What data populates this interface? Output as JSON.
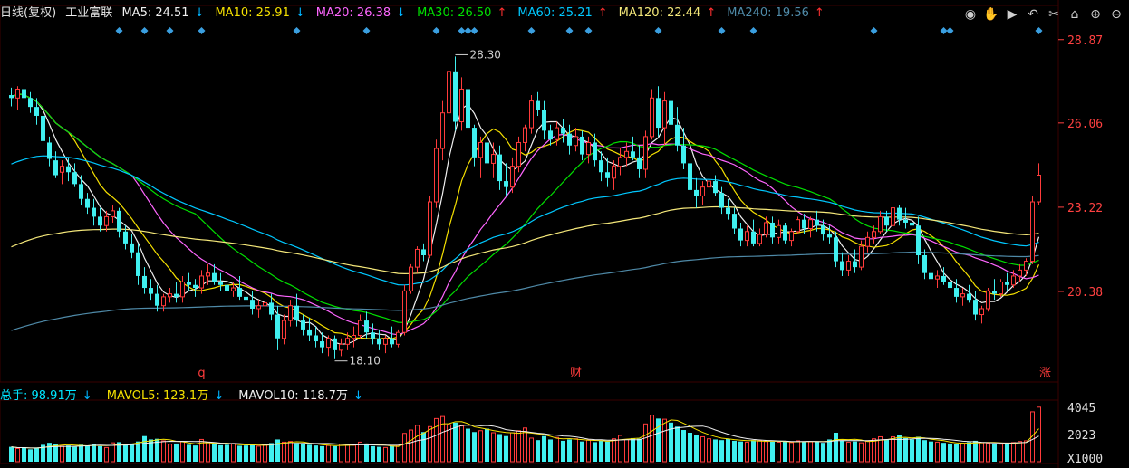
{
  "header": {
    "title": "日线(复权)",
    "stock_name": "工业富联",
    "indicators": [
      {
        "label": "MA5: 24.51",
        "arrow": "↓",
        "arrow_color": "#00b4ff",
        "color": "#f0f0f0"
      },
      {
        "label": "MA10: 25.91",
        "arrow": "↓",
        "arrow_color": "#00b4ff",
        "color": "#f5e000"
      },
      {
        "label": "MA20: 26.38",
        "arrow": "↓",
        "arrow_color": "#00b4ff",
        "color": "#ff66ff"
      },
      {
        "label": "MA30: 26.50",
        "arrow": "↑",
        "arrow_color": "#ff3030",
        "color": "#00e000"
      },
      {
        "label": "MA60: 25.21",
        "arrow": "↑",
        "arrow_color": "#ff3030",
        "color": "#00c8ff"
      },
      {
        "label": "MA120: 22.44",
        "arrow": "↑",
        "arrow_color": "#ff3030",
        "color": "#f5e87a"
      },
      {
        "label": "MA240: 19.56",
        "arrow": "↑",
        "arrow_color": "#ff3030",
        "color": "#4f8aa8"
      }
    ]
  },
  "toolbar": [
    "eye-icon",
    "hand-icon",
    "play-icon",
    "undo-icon",
    "scissors-icon",
    "lock-icon",
    "zoom-in-icon",
    "zoom-out-icon"
  ],
  "volume_header": {
    "total": {
      "label": "总手: 98.91万",
      "arrow": "↓",
      "color": "#00e5ff",
      "arrow_color": "#00b4ff"
    },
    "mavol5": {
      "label": "MAVOL5: 123.1万",
      "arrow": "↓",
      "color": "#f5e000",
      "arrow_color": "#00b4ff"
    },
    "mavol10": {
      "label": "MAVOL10: 118.7万",
      "arrow": "↓",
      "color": "#f0f0f0",
      "arrow_color": "#00b4ff"
    }
  },
  "colors": {
    "up": "#ff3b3b",
    "down": "#40f0f0",
    "grid": "#3a0000",
    "price_axis": "#ff4040",
    "vol_axis": "#e0e0e0",
    "diamond": "#3a9fe0"
  },
  "chart_data": {
    "type": "candlestick",
    "price_axis": {
      "ticks": [
        28.87,
        26.06,
        23.22,
        20.38
      ],
      "labels": [
        "28.87",
        "26.06",
        "23.22",
        "20.38"
      ],
      "ylim": [
        17.45,
        29.9
      ]
    },
    "volume_axis": {
      "ticks": [
        4045,
        2023
      ],
      "labels": [
        "4045",
        "2023"
      ],
      "unit_label": "X1000",
      "ylim": [
        0,
        4300
      ]
    },
    "annotations": [
      {
        "text": "28.30",
        "index": 70
      },
      {
        "text": "18.10",
        "index": 51
      }
    ],
    "event_markers": [
      {
        "text": "q",
        "index": 30
      },
      {
        "text": "财",
        "index": 89
      },
      {
        "text": "涨",
        "index": 163
      }
    ],
    "diamond_markers": [
      17,
      21,
      25,
      30,
      45,
      56,
      67,
      71,
      72,
      73,
      82,
      88,
      91,
      102,
      112,
      117,
      136,
      147,
      148,
      162
    ],
    "candles": [
      [
        27.0,
        27.25,
        26.62,
        26.9
      ],
      [
        26.9,
        27.3,
        26.5,
        27.2
      ],
      [
        27.2,
        27.4,
        26.8,
        26.9
      ],
      [
        26.9,
        27.1,
        26.4,
        26.6
      ],
      [
        26.6,
        26.9,
        26.0,
        26.3
      ],
      [
        26.3,
        26.5,
        25.2,
        25.45
      ],
      [
        25.4,
        25.6,
        24.6,
        24.85
      ],
      [
        24.8,
        25.1,
        24.2,
        24.3
      ],
      [
        24.4,
        24.8,
        24.0,
        24.6
      ],
      [
        24.6,
        24.9,
        24.1,
        24.4
      ],
      [
        24.4,
        24.7,
        23.9,
        24.0
      ],
      [
        24.0,
        24.3,
        23.3,
        23.5
      ],
      [
        23.5,
        23.7,
        23.0,
        23.2
      ],
      [
        23.2,
        23.5,
        22.6,
        22.9
      ],
      [
        22.9,
        23.2,
        22.4,
        22.6
      ],
      [
        22.6,
        23.1,
        22.4,
        22.9
      ],
      [
        22.9,
        23.3,
        22.7,
        23.1
      ],
      [
        23.1,
        23.2,
        22.2,
        22.4
      ],
      [
        22.4,
        22.6,
        21.8,
        22.0
      ],
      [
        22.0,
        22.3,
        21.5,
        21.7
      ],
      [
        21.7,
        22.0,
        20.6,
        20.9
      ],
      [
        20.9,
        21.2,
        20.3,
        20.5
      ],
      [
        20.5,
        20.8,
        20.1,
        20.3
      ],
      [
        20.3,
        20.6,
        19.7,
        19.9
      ],
      [
        19.9,
        20.3,
        19.7,
        20.2
      ],
      [
        20.2,
        20.5,
        20.0,
        20.3
      ],
      [
        20.3,
        20.7,
        20.0,
        20.2
      ],
      [
        20.2,
        20.9,
        20.0,
        20.7
      ],
      [
        20.7,
        21.0,
        20.4,
        20.6
      ],
      [
        20.6,
        20.8,
        20.2,
        20.5
      ],
      [
        20.5,
        21.1,
        20.3,
        20.9
      ],
      [
        20.9,
        21.3,
        20.6,
        21.0
      ],
      [
        21.0,
        21.3,
        20.6,
        20.7
      ],
      [
        20.7,
        21.0,
        20.4,
        20.6
      ],
      [
        20.6,
        20.8,
        20.1,
        20.4
      ],
      [
        20.4,
        20.7,
        20.2,
        20.5
      ],
      [
        20.5,
        20.9,
        20.1,
        20.2
      ],
      [
        20.2,
        20.5,
        19.9,
        20.1
      ],
      [
        20.1,
        20.4,
        19.6,
        19.8
      ],
      [
        19.8,
        20.1,
        19.5,
        19.9
      ],
      [
        19.9,
        20.2,
        19.7,
        20.0
      ],
      [
        20.0,
        20.3,
        19.4,
        19.6
      ],
      [
        19.6,
        19.9,
        18.4,
        18.8
      ],
      [
        18.8,
        19.6,
        18.6,
        19.4
      ],
      [
        19.4,
        20.1,
        19.2,
        19.9
      ],
      [
        19.9,
        20.3,
        19.2,
        19.4
      ],
      [
        19.4,
        19.6,
        18.9,
        19.1
      ],
      [
        19.1,
        19.5,
        18.7,
        18.9
      ],
      [
        18.9,
        19.2,
        18.5,
        18.7
      ],
      [
        18.7,
        19.0,
        18.3,
        18.5
      ],
      [
        18.5,
        18.9,
        18.2,
        18.8
      ],
      [
        18.8,
        18.9,
        18.1,
        18.4
      ],
      [
        18.4,
        18.8,
        18.2,
        18.6
      ],
      [
        18.6,
        19.0,
        18.4,
        18.8
      ],
      [
        18.8,
        19.2,
        18.5,
        18.9
      ],
      [
        18.9,
        19.6,
        18.8,
        19.4
      ],
      [
        19.4,
        19.7,
        18.8,
        19.0
      ],
      [
        19.0,
        19.3,
        18.6,
        18.8
      ],
      [
        18.8,
        19.1,
        18.4,
        18.6
      ],
      [
        18.6,
        18.9,
        18.3,
        18.8
      ],
      [
        18.8,
        19.2,
        18.5,
        18.6
      ],
      [
        18.6,
        19.1,
        18.5,
        19.0
      ],
      [
        19.0,
        20.6,
        18.9,
        20.4
      ],
      [
        20.4,
        21.3,
        20.3,
        21.2
      ],
      [
        21.2,
        21.9,
        21.0,
        21.8
      ],
      [
        21.8,
        22.0,
        21.4,
        21.6
      ],
      [
        21.6,
        23.6,
        21.5,
        23.4
      ],
      [
        23.4,
        25.5,
        23.2,
        25.2
      ],
      [
        25.2,
        26.8,
        24.8,
        26.4
      ],
      [
        26.4,
        28.3,
        26.0,
        27.8
      ],
      [
        27.8,
        28.3,
        25.8,
        26.1
      ],
      [
        26.1,
        27.6,
        25.8,
        27.2
      ],
      [
        27.2,
        27.8,
        25.6,
        25.9
      ],
      [
        25.9,
        26.0,
        24.6,
        24.9
      ],
      [
        24.9,
        25.6,
        24.2,
        25.4
      ],
      [
        25.4,
        25.9,
        24.5,
        24.7
      ],
      [
        24.7,
        25.4,
        24.2,
        25.0
      ],
      [
        25.0,
        25.3,
        23.8,
        24.1
      ],
      [
        24.1,
        24.7,
        23.6,
        23.9
      ],
      [
        23.9,
        24.9,
        23.7,
        24.6
      ],
      [
        24.6,
        25.6,
        24.4,
        25.4
      ],
      [
        25.4,
        26.0,
        25.1,
        25.9
      ],
      [
        25.9,
        27.0,
        25.7,
        26.8
      ],
      [
        26.8,
        27.1,
        26.3,
        26.5
      ],
      [
        26.5,
        26.8,
        25.5,
        25.8
      ],
      [
        25.8,
        26.0,
        25.3,
        25.5
      ],
      [
        25.5,
        26.1,
        25.3,
        25.9
      ],
      [
        25.9,
        26.2,
        25.4,
        25.7
      ],
      [
        25.7,
        26.0,
        25.0,
        25.3
      ],
      [
        25.3,
        25.9,
        25.1,
        25.6
      ],
      [
        25.6,
        25.8,
        24.8,
        25.0
      ],
      [
        25.0,
        25.6,
        24.7,
        25.4
      ],
      [
        25.4,
        25.7,
        24.6,
        24.8
      ],
      [
        24.8,
        25.1,
        24.1,
        24.4
      ],
      [
        24.4,
        24.9,
        23.9,
        24.2
      ],
      [
        24.2,
        24.8,
        23.8,
        24.6
      ],
      [
        24.6,
        25.2,
        24.3,
        24.9
      ],
      [
        24.9,
        25.4,
        24.6,
        25.1
      ],
      [
        25.1,
        25.6,
        24.8,
        24.9
      ],
      [
        24.9,
        25.3,
        24.2,
        24.5
      ],
      [
        24.5,
        25.8,
        24.2,
        25.6
      ],
      [
        25.6,
        27.2,
        25.5,
        26.9
      ],
      [
        26.9,
        27.3,
        25.6,
        25.9
      ],
      [
        25.9,
        27.1,
        25.3,
        26.8
      ],
      [
        26.8,
        27.0,
        25.7,
        26.0
      ],
      [
        26.0,
        26.6,
        25.1,
        25.3
      ],
      [
        25.3,
        25.9,
        24.5,
        24.7
      ],
      [
        24.7,
        24.9,
        23.5,
        23.8
      ],
      [
        23.8,
        24.2,
        23.2,
        23.6
      ],
      [
        23.6,
        24.1,
        23.3,
        23.9
      ],
      [
        23.9,
        24.4,
        23.7,
        24.1
      ],
      [
        24.1,
        24.3,
        23.6,
        23.7
      ],
      [
        23.7,
        23.9,
        23.0,
        23.2
      ],
      [
        23.2,
        23.5,
        22.8,
        23.0
      ],
      [
        23.0,
        23.2,
        22.3,
        22.5
      ],
      [
        22.5,
        22.7,
        21.9,
        22.1
      ],
      [
        22.1,
        22.6,
        21.9,
        22.4
      ],
      [
        22.4,
        22.8,
        21.9,
        22.0
      ],
      [
        22.0,
        22.5,
        21.9,
        22.3
      ],
      [
        22.3,
        22.9,
        22.2,
        22.7
      ],
      [
        22.7,
        22.9,
        22.0,
        22.2
      ],
      [
        22.2,
        22.8,
        22.0,
        22.6
      ],
      [
        22.6,
        22.7,
        22.0,
        22.1
      ],
      [
        22.1,
        22.5,
        21.9,
        22.4
      ],
      [
        22.4,
        22.9,
        22.3,
        22.8
      ],
      [
        22.8,
        23.0,
        22.3,
        22.5
      ],
      [
        22.5,
        22.9,
        22.2,
        22.8
      ],
      [
        22.8,
        23.1,
        22.4,
        22.6
      ],
      [
        22.6,
        22.8,
        22.1,
        22.3
      ],
      [
        22.3,
        22.6,
        22.0,
        22.2
      ],
      [
        22.2,
        22.4,
        21.2,
        21.4
      ],
      [
        21.4,
        21.7,
        20.9,
        21.1
      ],
      [
        21.1,
        21.6,
        20.9,
        21.4
      ],
      [
        21.4,
        21.8,
        21.0,
        21.2
      ],
      [
        21.2,
        22.1,
        21.1,
        21.9
      ],
      [
        21.9,
        22.4,
        21.7,
        22.2
      ],
      [
        22.2,
        22.6,
        22.0,
        22.4
      ],
      [
        22.4,
        23.1,
        22.3,
        22.9
      ],
      [
        22.9,
        23.1,
        22.4,
        22.6
      ],
      [
        22.6,
        23.4,
        22.5,
        23.2
      ],
      [
        23.2,
        23.3,
        22.6,
        22.8
      ],
      [
        22.8,
        23.2,
        22.5,
        22.7
      ],
      [
        22.7,
        23.1,
        22.4,
        22.6
      ],
      [
        22.6,
        22.9,
        21.3,
        21.6
      ],
      [
        21.6,
        21.8,
        20.8,
        21.0
      ],
      [
        21.0,
        21.4,
        20.6,
        20.8
      ],
      [
        20.8,
        21.1,
        20.5,
        20.9
      ],
      [
        20.9,
        21.2,
        20.6,
        20.7
      ],
      [
        20.7,
        20.9,
        20.2,
        20.5
      ],
      [
        20.5,
        20.8,
        20.0,
        20.2
      ],
      [
        20.2,
        20.5,
        19.9,
        20.3
      ],
      [
        20.3,
        20.6,
        20.0,
        20.1
      ],
      [
        20.1,
        20.4,
        19.4,
        19.6
      ],
      [
        19.6,
        19.9,
        19.3,
        19.8
      ],
      [
        19.8,
        20.5,
        19.7,
        20.4
      ],
      [
        20.4,
        20.8,
        20.1,
        20.3
      ],
      [
        20.3,
        20.8,
        20.2,
        20.7
      ],
      [
        20.7,
        21.0,
        20.4,
        20.6
      ],
      [
        20.6,
        21.1,
        20.5,
        20.9
      ],
      [
        20.9,
        21.3,
        20.7,
        21.1
      ],
      [
        21.1,
        21.5,
        20.9,
        21.4
      ],
      [
        21.4,
        23.6,
        21.3,
        23.4
      ],
      [
        23.4,
        24.7,
        23.3,
        24.3
      ]
    ],
    "volumes": [
      1100,
      980,
      1050,
      920,
      1010,
      1250,
      1400,
      1300,
      1150,
      1200,
      1100,
      1260,
      1180,
      1300,
      1150,
      1050,
      1400,
      1450,
      1300,
      1350,
      1500,
      1900,
      1650,
      1700,
      1550,
      1300,
      1350,
      1500,
      1250,
      1200,
      1650,
      1450,
      1300,
      1220,
      1250,
      1350,
      1180,
      1200,
      1280,
      1150,
      1250,
      1380,
      1650,
      1450,
      1500,
      1400,
      1300,
      1250,
      1200,
      1150,
      1200,
      1150,
      1300,
      1250,
      1220,
      1450,
      1350,
      1150,
      1100,
      1050,
      1150,
      1200,
      2100,
      2350,
      2700,
      2200,
      2600,
      3200,
      3350,
      2750,
      2900,
      2650,
      2450,
      2200,
      2300,
      2450,
      2150,
      2050,
      1900,
      2150,
      2300,
      2500,
      1750,
      1600,
      1900,
      1650,
      1800,
      1550,
      1650,
      1700,
      1500,
      1600,
      1450,
      1550,
      1500,
      1700,
      1950,
      1650,
      1750,
      1700,
      2800,
      3450,
      3200,
      3150,
      2900,
      2600,
      2350,
      2150,
      1950,
      1850,
      1700,
      1650,
      1600,
      1700,
      1550,
      1500,
      1450,
      1600,
      1550,
      1500,
      1480,
      1450,
      1500,
      1420,
      1550,
      1500,
      1480,
      1520,
      1400,
      1650,
      2150,
      1550,
      1450,
      1500,
      1400,
      1550,
      1700,
      1850,
      1650,
      1850,
      1950,
      1750,
      1650,
      1850,
      1600,
      1500,
      1450,
      1400,
      1350,
      1300,
      1350,
      1450,
      1550,
      1400,
      1380,
      1350,
      1300,
      1400,
      1420,
      1500,
      1550,
      3700,
      4045
    ]
  }
}
